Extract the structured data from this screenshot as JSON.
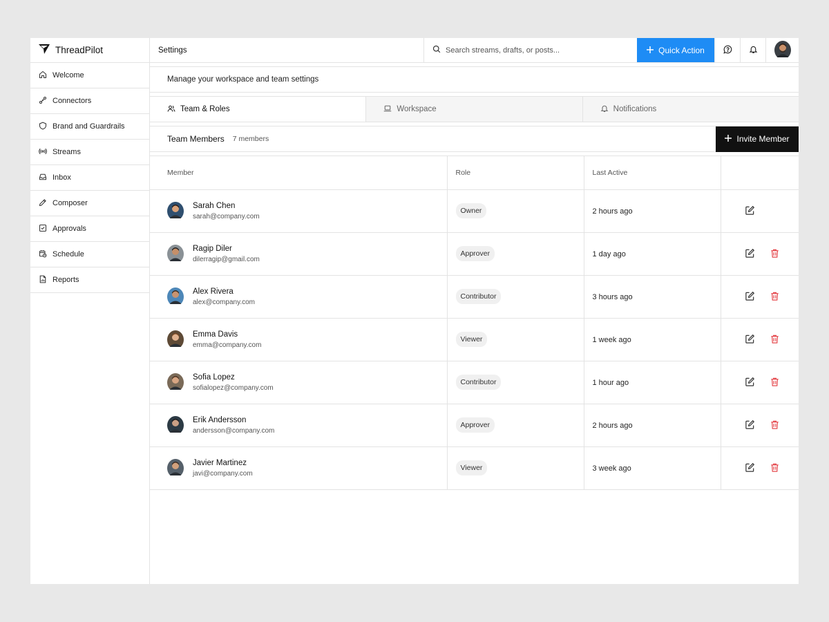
{
  "brand": {
    "name": "ThreadPilot"
  },
  "sidebar": {
    "items": [
      {
        "label": "Welcome",
        "icon": "home-icon"
      },
      {
        "label": "Connectors",
        "icon": "plug-icon"
      },
      {
        "label": "Brand and Guardrails",
        "icon": "shield-icon"
      },
      {
        "label": "Streams",
        "icon": "broadcast-icon"
      },
      {
        "label": "Inbox",
        "icon": "inbox-icon"
      },
      {
        "label": "Composer",
        "icon": "pencil-icon"
      },
      {
        "label": "Approvals",
        "icon": "check-square-icon"
      },
      {
        "label": "Schedule",
        "icon": "calendar-clock-icon"
      },
      {
        "label": "Reports",
        "icon": "file-report-icon"
      }
    ]
  },
  "header": {
    "title": "Settings",
    "search_placeholder": "Search streams, drafts, or posts...",
    "quick_action_label": "Quick Action"
  },
  "page": {
    "subtitle": "Manage your workspace and team settings",
    "tabs": [
      {
        "label": "Team & Roles",
        "icon": "users-icon",
        "active": true
      },
      {
        "label": "Workspace",
        "icon": "laptop-icon",
        "active": false
      },
      {
        "label": "Notifications",
        "icon": "bell-icon",
        "active": false
      }
    ],
    "members_title": "Team Members",
    "members_count": "7 members",
    "invite_label": "Invite Member"
  },
  "table": {
    "headers": {
      "member": "Member",
      "role": "Role",
      "last_active": "Last Active"
    },
    "rows": [
      {
        "name": "Sarah Chen",
        "email": "sarah@company.com",
        "role": "Owner",
        "last_active": "2 hours ago",
        "can_delete": false
      },
      {
        "name": "Ragip Diler",
        "email": "dilerragip@gmail.com",
        "role": "Approver",
        "last_active": "1 day ago",
        "can_delete": true
      },
      {
        "name": "Alex Rivera",
        "email": "alex@company.com",
        "role": "Contributor",
        "last_active": "3 hours ago",
        "can_delete": true
      },
      {
        "name": "Emma Davis",
        "email": "emma@company.com",
        "role": "Viewer",
        "last_active": "1 week ago",
        "can_delete": true
      },
      {
        "name": "Sofia Lopez",
        "email": "sofialopez@company.com",
        "role": "Contributor",
        "last_active": "1 hour ago",
        "can_delete": true
      },
      {
        "name": "Erik Andersson",
        "email": "andersson@company.com",
        "role": "Approver",
        "last_active": "2 hours ago",
        "can_delete": true
      },
      {
        "name": "Javier Martinez",
        "email": "javi@company.com",
        "role": "Viewer",
        "last_active": "3 week ago",
        "can_delete": true
      }
    ]
  },
  "colors": {
    "accent": "#1e8cf5",
    "danger": "#e5484d",
    "dark": "#111111",
    "border": "#e3e3e3"
  }
}
